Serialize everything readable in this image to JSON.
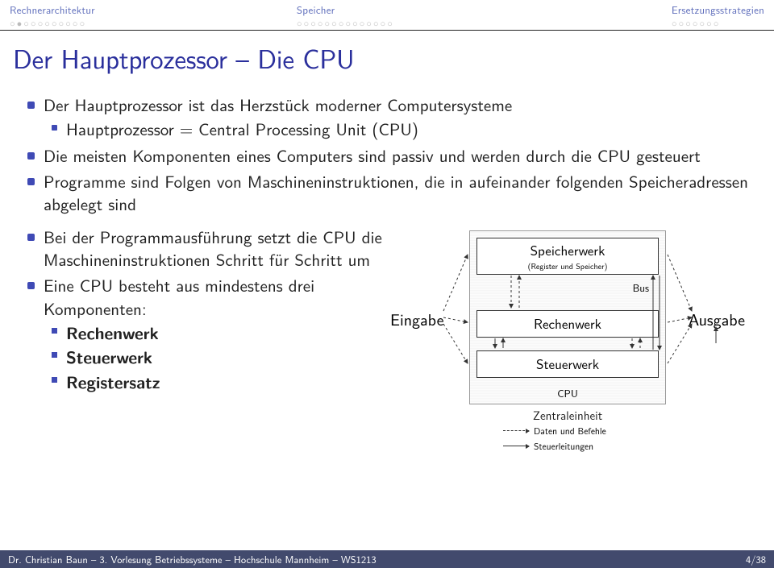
{
  "nav": {
    "sec1": {
      "label": "Rechnerarchitektur",
      "dots": "○●○○○○○○○○○"
    },
    "sec2": {
      "label": "Speicher",
      "dots": "○○○○○○○○○○○○○○"
    },
    "sec3": {
      "label": "Ersetzungsstrategien",
      "dots": "○○○○○○○"
    }
  },
  "title": "Der Hauptprozessor – Die CPU",
  "bullets": {
    "b1": "Der Hauptprozessor ist das Herzstück moderner Computersysteme",
    "b1s1": "Hauptprozessor = Central Processing Unit (CPU)",
    "b2": "Die meisten Komponenten eines Computers sind passiv und werden durch die CPU gesteuert",
    "b3": "Programme sind Folgen von Maschineninstruktionen, die in aufeinander folgenden Speicheradressen abgelegt sind",
    "b4": "Bei der Programmausführung setzt die CPU die Maschineninstruktionen Schritt für Schritt um",
    "b5": "Eine CPU besteht aus mindestens drei Komponenten:",
    "b5s1": "Rechenwerk",
    "b5s2": "Steuerwerk",
    "b5s3": "Registersatz"
  },
  "diagram": {
    "eingabe": "Eingabe",
    "ausgabe": "Ausgabe",
    "box1_t1": "Speicherwerk",
    "box1_t2": "(Register und Speicher)",
    "bus": "Bus",
    "box2": "Rechenwerk",
    "box3": "Steuerwerk",
    "cpu": "CPU",
    "ze": "Zentraleinheit",
    "legend1": "Daten und Befehle",
    "legend2": "Steuerleitungen"
  },
  "footer": {
    "left": "Dr. Christian Baun – 3. Vorlesung Betriebssysteme – Hochschule Mannheim – WS1213",
    "right": "4/38"
  }
}
